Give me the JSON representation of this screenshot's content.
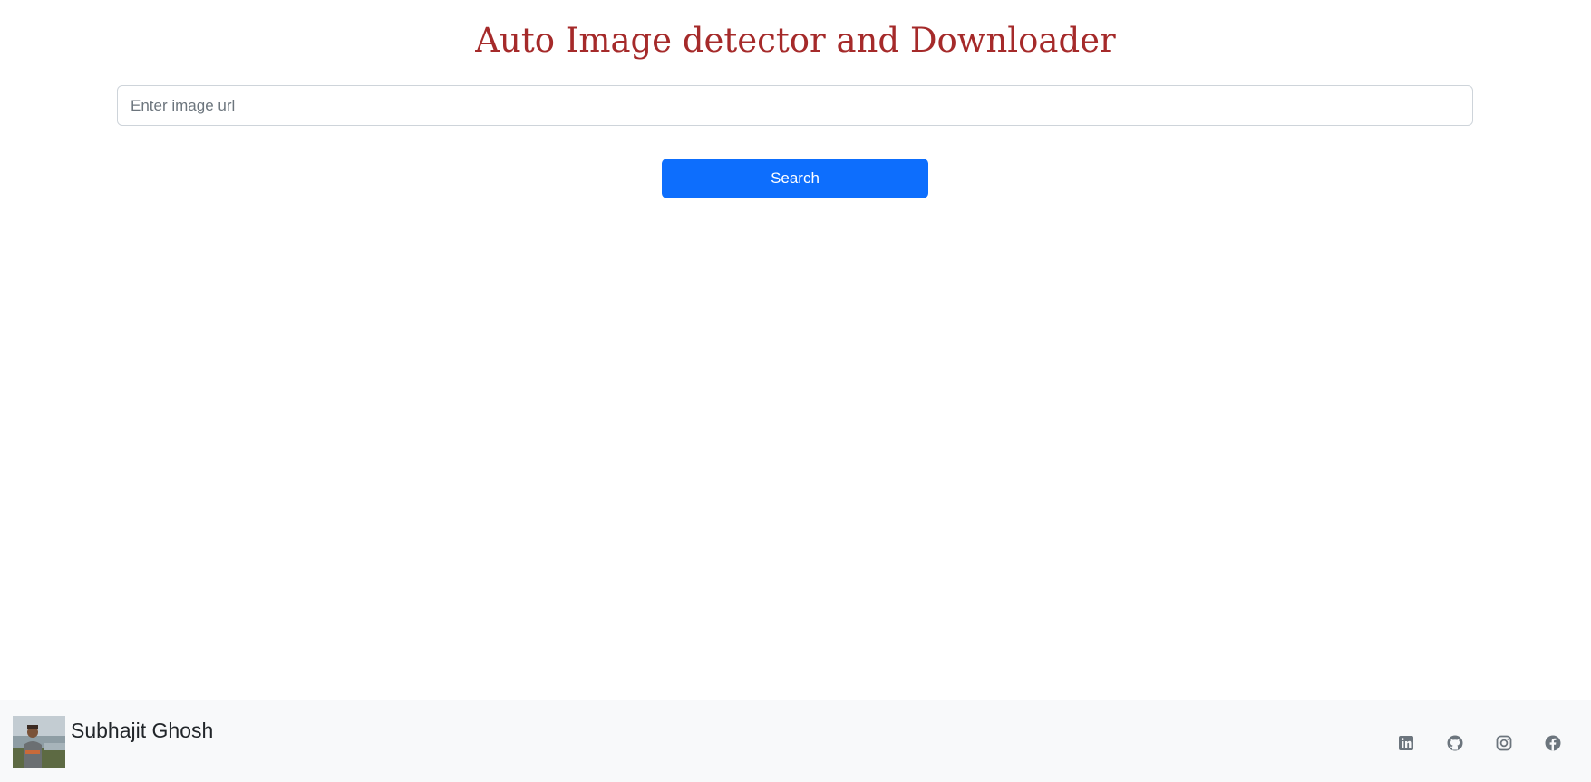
{
  "header": {
    "title": "Auto Image detector and Downloader"
  },
  "search": {
    "value": "",
    "placeholder": "Enter image url",
    "button_label": "Search"
  },
  "footer": {
    "author_name": "Subhajit Ghosh",
    "social_icons": [
      "linkedin-icon",
      "github-icon",
      "instagram-icon",
      "facebook-icon"
    ]
  },
  "colors": {
    "title": "#a52a2a",
    "button": "#0d6efd",
    "footer_bg": "#f8f9fa",
    "icon": "#6c757d"
  }
}
